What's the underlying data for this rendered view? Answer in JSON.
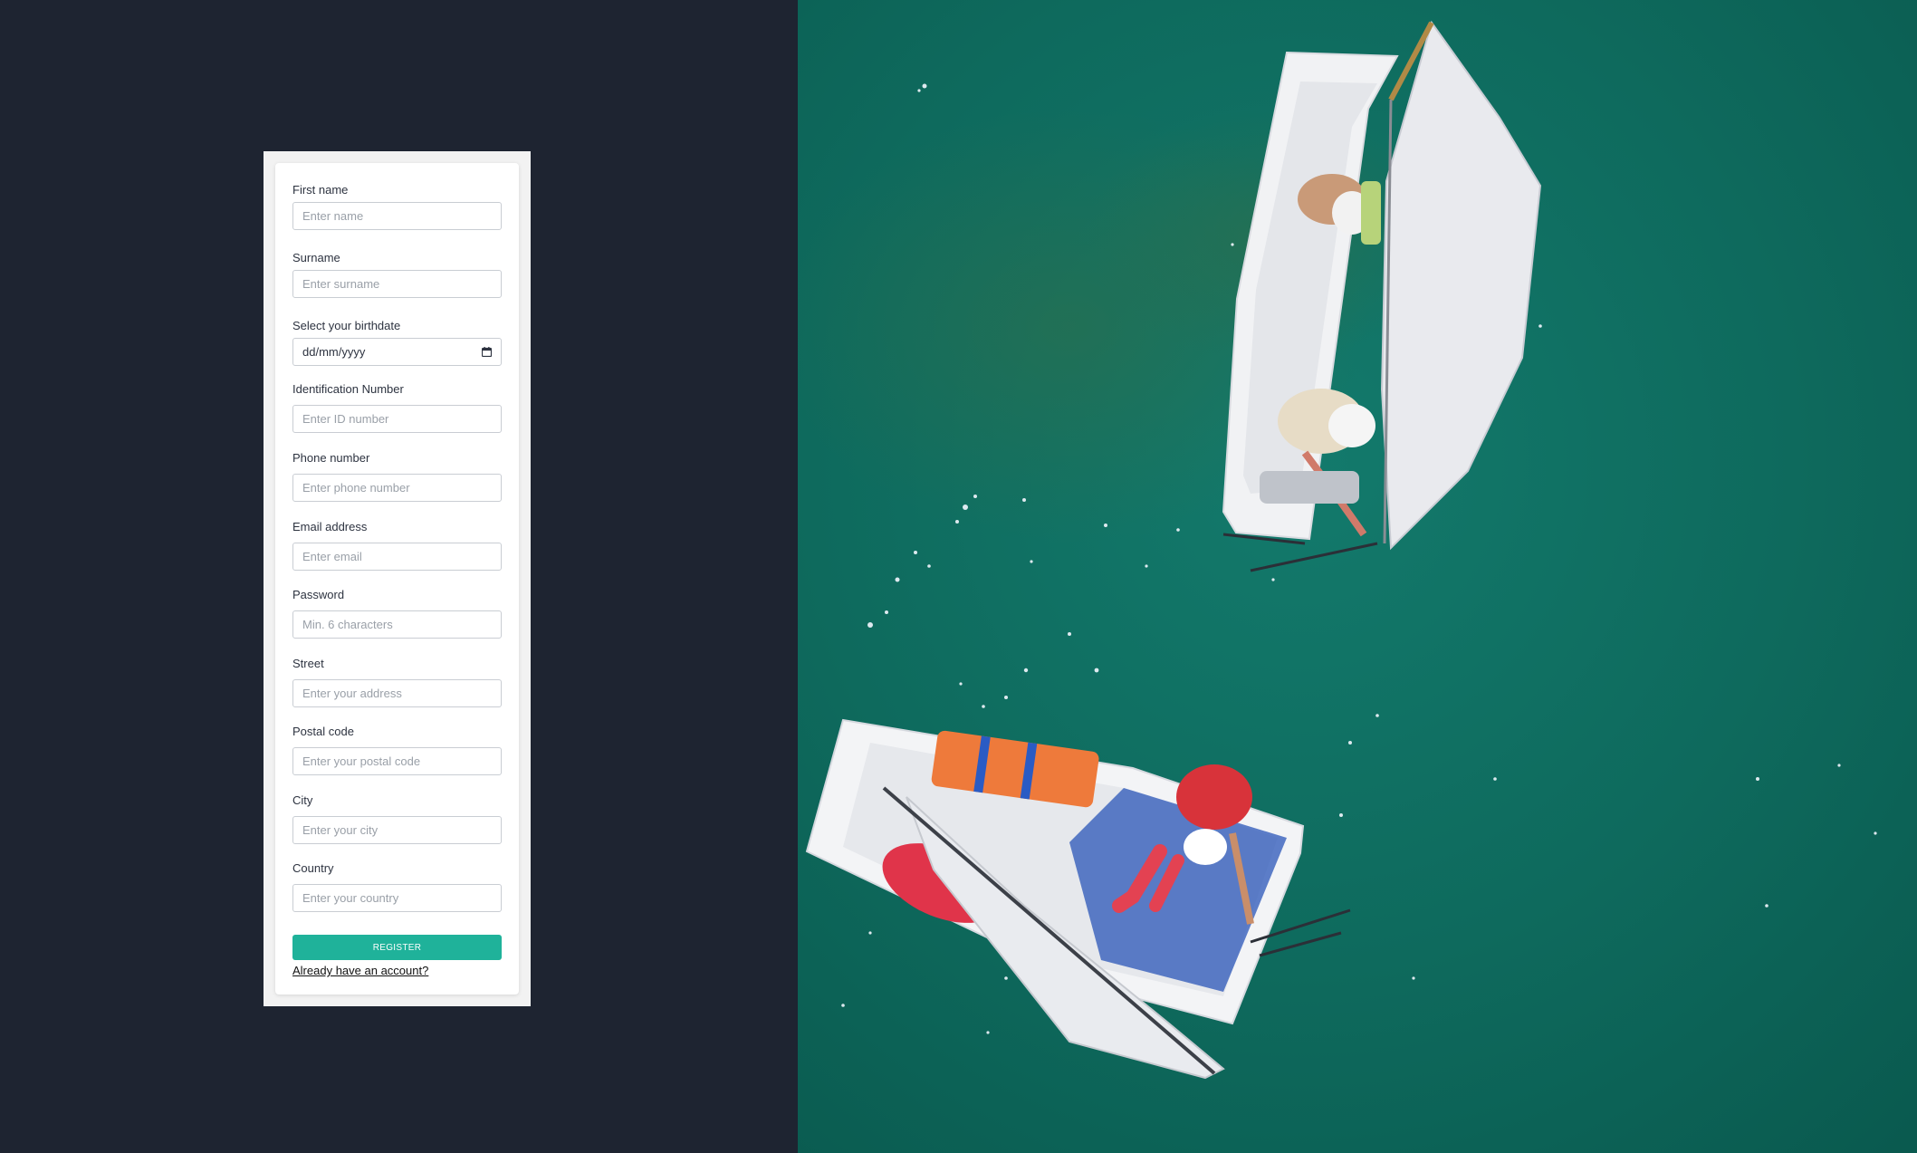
{
  "form": {
    "fields": [
      {
        "label": "First name",
        "placeholder": "Enter name",
        "type": "text"
      },
      {
        "label": "Surname",
        "placeholder": "Enter surname",
        "type": "text"
      },
      {
        "label": "Select your birthdate",
        "value": "dd/mm/yyyy",
        "type": "date"
      },
      {
        "label": "Identification Number",
        "placeholder": "Enter ID number",
        "type": "text"
      },
      {
        "label": "Phone number",
        "placeholder": "Enter phone number",
        "type": "text"
      },
      {
        "label": "Email address",
        "placeholder": "Enter email",
        "type": "email"
      },
      {
        "label": "Password",
        "placeholder": "Min. 6 characters",
        "type": "password"
      },
      {
        "label": "Street",
        "placeholder": "Enter your address",
        "type": "text"
      },
      {
        "label": "Postal code",
        "placeholder": "Enter your postal code",
        "type": "text"
      },
      {
        "label": "City",
        "placeholder": "Enter your city",
        "type": "text"
      },
      {
        "label": "Country",
        "placeholder": "Enter your country",
        "type": "text"
      }
    ],
    "register_label": "REGISTER",
    "login_link": "Already have an account?",
    "birthdate_icon": "calendar-icon"
  },
  "colors": {
    "left_background": "#1e2431",
    "accent": "#1fb29a",
    "water": "#0f6b5f"
  },
  "photo": {
    "subject": "aerial view of two sailing dinghies on green water"
  }
}
